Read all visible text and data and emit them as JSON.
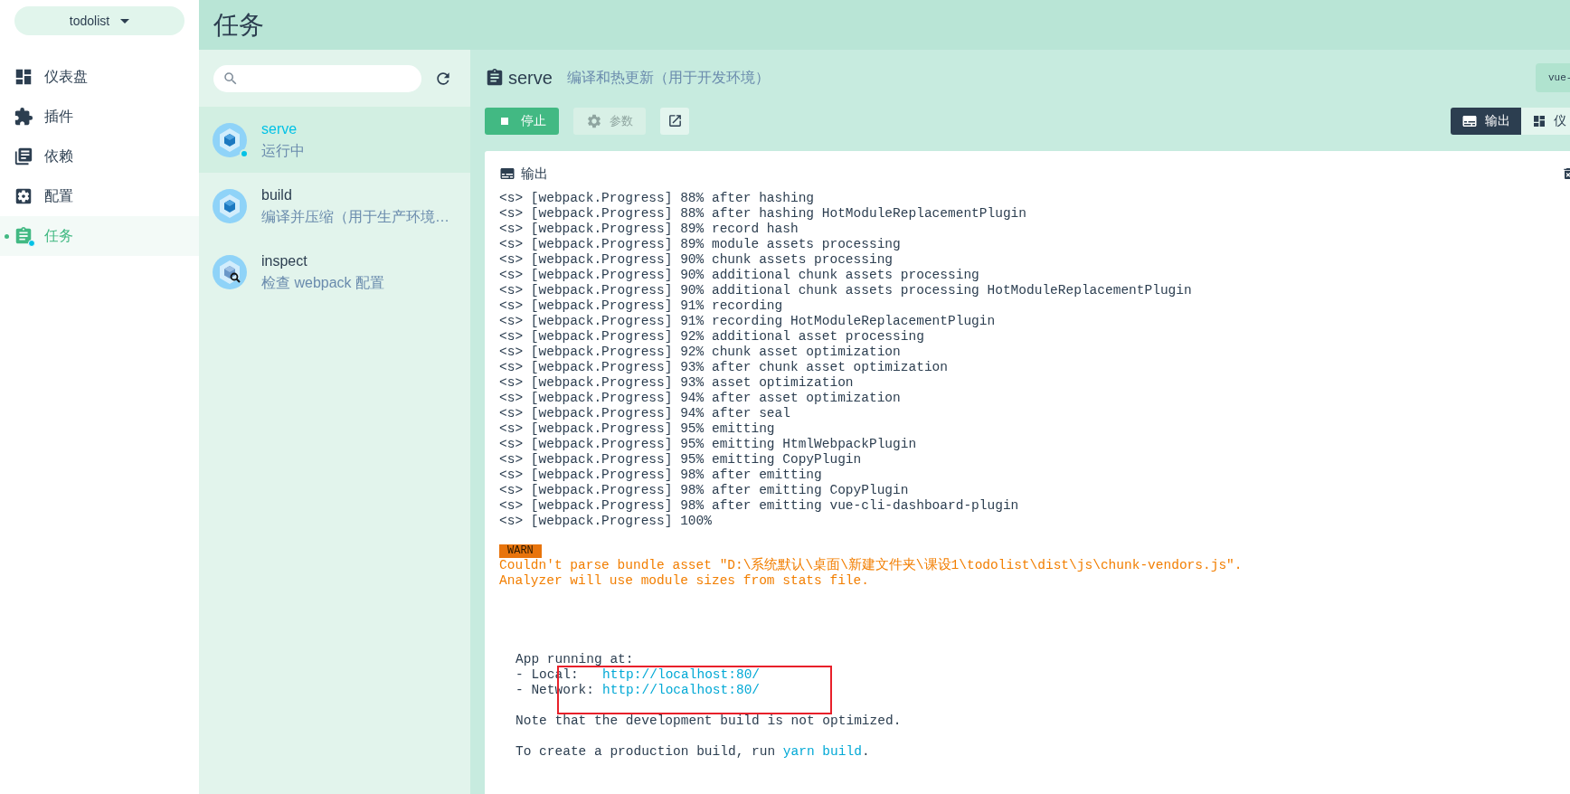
{
  "project_selector": {
    "label": "todolist"
  },
  "nav": [
    {
      "label": "仪表盘",
      "kind": "dashboard",
      "selected": false,
      "running": false
    },
    {
      "label": "插件",
      "kind": "plugins",
      "selected": false,
      "running": false
    },
    {
      "label": "依赖",
      "kind": "dependencies",
      "selected": false,
      "running": false
    },
    {
      "label": "配置",
      "kind": "config",
      "selected": false,
      "running": false
    },
    {
      "label": "任务",
      "kind": "tasks",
      "selected": true,
      "running": true
    }
  ],
  "page_title": "任务",
  "tasks": [
    {
      "name": "serve",
      "description": "运行中",
      "kind": "webpack",
      "selected": true,
      "running": true
    },
    {
      "name": "build",
      "description": "编译并压缩（用于生产环境…",
      "kind": "webpack",
      "selected": false,
      "running": false
    },
    {
      "name": "inspect",
      "description": "检查 webpack 配置",
      "kind": "inspect",
      "selected": false,
      "running": false
    }
  ],
  "task": {
    "name": "serve",
    "description": "编译和热更新（用于开发环境）"
  },
  "stop_button": {
    "label": "停止"
  },
  "params_button": {
    "label": "参数",
    "disabled": true
  },
  "corner_button": {
    "label": "vue-"
  },
  "view_tabs": [
    {
      "label": "输出",
      "selected": true
    },
    {
      "label": "仪",
      "selected": false
    }
  ],
  "output": {
    "title": "输出",
    "lines": [
      "<s> [webpack.Progress] 88% after hashing",
      "<s> [webpack.Progress] 88% after hashing HotModuleReplacementPlugin",
      "<s> [webpack.Progress] 89% record hash",
      "<s> [webpack.Progress] 89% module assets processing",
      "<s> [webpack.Progress] 90% chunk assets processing",
      "<s> [webpack.Progress] 90% additional chunk assets processing",
      "<s> [webpack.Progress] 90% additional chunk assets processing HotModuleReplacementPlugin",
      "<s> [webpack.Progress] 91% recording",
      "<s> [webpack.Progress] 91% recording HotModuleReplacementPlugin",
      "<s> [webpack.Progress] 92% additional asset processing",
      "<s> [webpack.Progress] 92% chunk asset optimization",
      "<s> [webpack.Progress] 93% after chunk asset optimization",
      "<s> [webpack.Progress] 93% asset optimization",
      "<s> [webpack.Progress] 94% after asset optimization",
      "<s> [webpack.Progress] 94% after seal",
      "<s> [webpack.Progress] 95% emitting",
      "<s> [webpack.Progress] 95% emitting HtmlWebpackPlugin",
      "<s> [webpack.Progress] 95% emitting CopyPlugin",
      "<s> [webpack.Progress] 98% after emitting",
      "<s> [webpack.Progress] 98% after emitting CopyPlugin",
      "<s> [webpack.Progress] 98% after emitting vue-cli-dashboard-plugin",
      "<s> [webpack.Progress] 100%"
    ],
    "warning": {
      "badge": "WARN",
      "lines": [
        "Couldn't parse bundle asset \"D:\\系统默认\\桌面\\新建文件夹\\课设1\\todolist\\dist\\js\\chunk-vendors.js\".",
        "Analyzer will use module sizes from stats file."
      ]
    },
    "running_title": "App running at:",
    "urls": [
      {
        "label": "- Local:",
        "url": "http://localhost:80/"
      },
      {
        "label": "- Network:",
        "url": "http://localhost:80/"
      }
    ],
    "note": "Note that the development build is not optimized.",
    "build_hint": {
      "text": "To create a production build, run",
      "command": "yarn build",
      "after": "."
    }
  }
}
